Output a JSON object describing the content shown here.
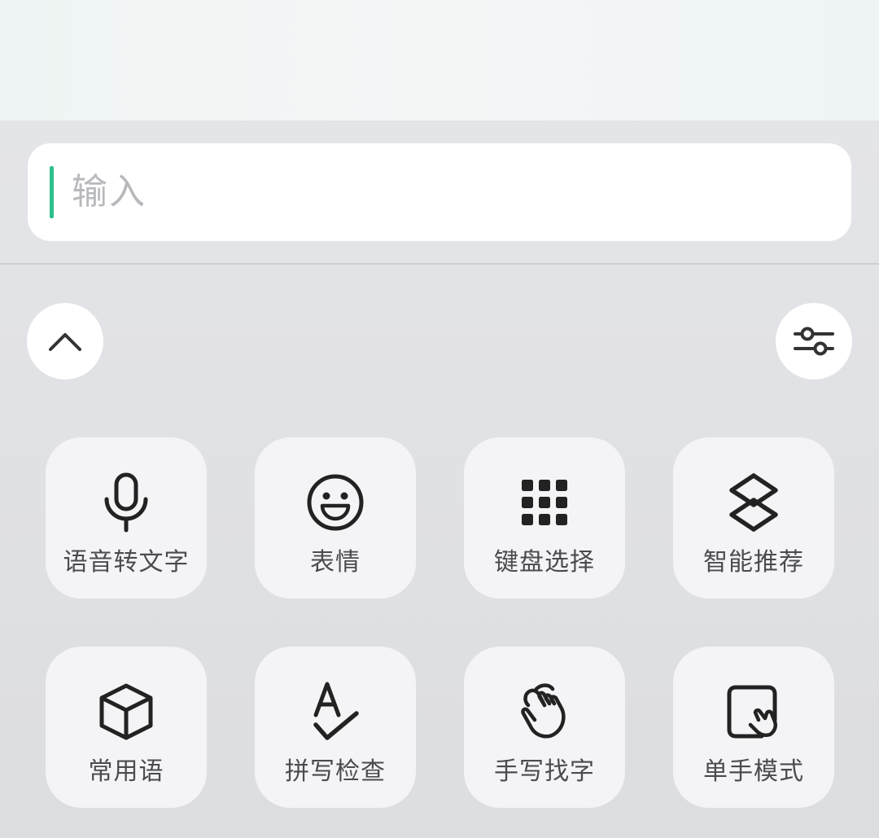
{
  "input": {
    "placeholder": "输入"
  },
  "controls": {
    "collapse_icon": "chevron-up-icon",
    "settings_icon": "sliders-icon"
  },
  "tools": [
    {
      "label": "语音转文字",
      "icon": "microphone-icon"
    },
    {
      "label": "表情",
      "icon": "smiley-icon"
    },
    {
      "label": "键盘选择",
      "icon": "keypad-grid-icon"
    },
    {
      "label": "智能推荐",
      "icon": "smart-recommend-icon"
    },
    {
      "label": "常用语",
      "icon": "cube-icon"
    },
    {
      "label": "拼写检查",
      "icon": "spell-check-icon"
    },
    {
      "label": "手写找字",
      "icon": "hand-gesture-icon"
    },
    {
      "label": "单手模式",
      "icon": "one-hand-mode-icon"
    }
  ],
  "colors": {
    "caret": "#2cc08a",
    "tile_bg": "#f4f4f6",
    "label": "#4a4b4e"
  }
}
